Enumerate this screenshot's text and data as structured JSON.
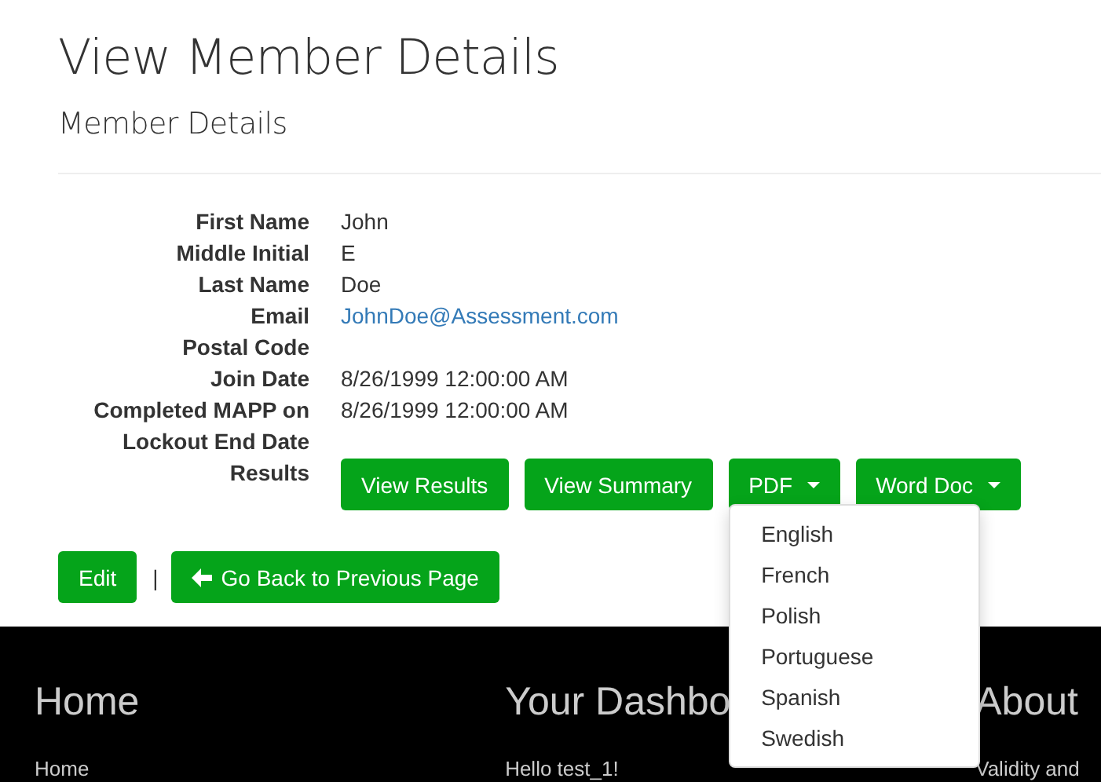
{
  "page_title": "View Member Details",
  "section_title": "Member Details",
  "fields": [
    {
      "label": "First Name",
      "value": "John",
      "kind": "text"
    },
    {
      "label": "Middle Initial",
      "value": "E",
      "kind": "text"
    },
    {
      "label": "Last Name",
      "value": "Doe",
      "kind": "text"
    },
    {
      "label": "Email",
      "value": "JohnDoe@Assessment.com",
      "kind": "link"
    },
    {
      "label": "Postal Code",
      "kind": "text"
    },
    {
      "label": "Join Date",
      "value": "8/26/1999 12:00:00 AM",
      "kind": "text"
    },
    {
      "label": "Completed MAPP on",
      "value": "8/26/1999 12:00:00 AM",
      "kind": "text"
    },
    {
      "label": "Lockout End Date",
      "kind": "text"
    }
  ],
  "results": {
    "label": "Results",
    "buttons": [
      {
        "label": "View Results",
        "kind": "plain"
      },
      {
        "label": "View Summary",
        "kind": "plain"
      },
      {
        "label": "PDF",
        "kind": "dropdown",
        "expanded": true,
        "menu": [
          "English",
          "French",
          "Polish",
          "Portuguese",
          "Spanish",
          "Swedish"
        ]
      },
      {
        "label": "Word Doc",
        "kind": "dropdown",
        "expanded": false
      }
    ]
  },
  "actions": {
    "edit": "Edit",
    "separator": "|",
    "back": "Go Back to Previous Page"
  },
  "footer": [
    {
      "heading": "Home",
      "link": "Home"
    },
    {
      "heading": "Your Dashbo",
      "link": "Hello test_1!"
    },
    {
      "heading": "About",
      "link": "Validity and"
    }
  ]
}
